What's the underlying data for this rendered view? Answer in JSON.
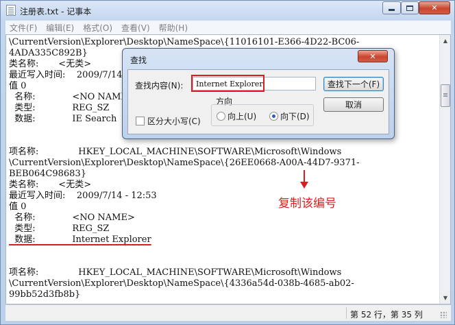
{
  "window": {
    "title": "注册表.txt - 记事本",
    "minimize": "",
    "maximize": "",
    "close": "✕"
  },
  "menu": [
    {
      "label": "文件(F)"
    },
    {
      "label": "编辑(E)"
    },
    {
      "label": "格式(O)"
    },
    {
      "label": "查看(V)"
    },
    {
      "label": "帮助(H)"
    }
  ],
  "editor": {
    "lines": [
      "\\CurrentVersion\\Explorer\\Desktop\\NameSpace\\{11016101-E366-4D22-BC06-",
      "4ADA335C892B}",
      "类名称:       <无类>",
      "最近写入时间:    2009/7/14 - 12:53",
      "值 0",
      "  名称:             <NO NAME>",
      "  类型:             REG_SZ",
      "  数据:             IE Search",
      "",
      "",
      "项名称:              HKEY_LOCAL_MACHINE\\SOFTWARE\\Microsoft\\Windows",
      "\\CurrentVersion\\Explorer\\Desktop\\NameSpace\\{26EE0668-A00A-44D7-9371-",
      "BEB064C98683}",
      "类名称:       <无类>",
      "最近写入时间:    2009/7/14 - 12:53",
      "值 0",
      "  名称:             <NO NAME>",
      "  类型:             REG_SZ",
      "  数据:             Internet Explorer",
      "",
      "",
      "项名称:              HKEY_LOCAL_MACHINE\\SOFTWARE\\Microsoft\\Windows",
      "\\CurrentVersion\\Explorer\\Desktop\\NameSpace\\{4336a54d-038b-4685-ab02-",
      "99bb52d3fb8b}"
    ],
    "marked_line": 18
  },
  "annotation": {
    "text": "复制该编号",
    "color": "#d81e1e"
  },
  "status": {
    "position": "第 52 行，第 35 列"
  },
  "dialog": {
    "title": "查找",
    "close": "✕",
    "find_label": "查找内容(N):",
    "find_value": "Internet Explorer",
    "find_next": "查找下一个(F)",
    "cancel": "取消",
    "direction": "方向",
    "up": "向上(U)",
    "down": "向下(D)",
    "selected_direction": "down",
    "match_case": "区分大小写(C)",
    "match_case_checked": false
  },
  "icons": {
    "app": "notepad-icon",
    "scroll_up": "▲",
    "scroll_down": "▼"
  }
}
